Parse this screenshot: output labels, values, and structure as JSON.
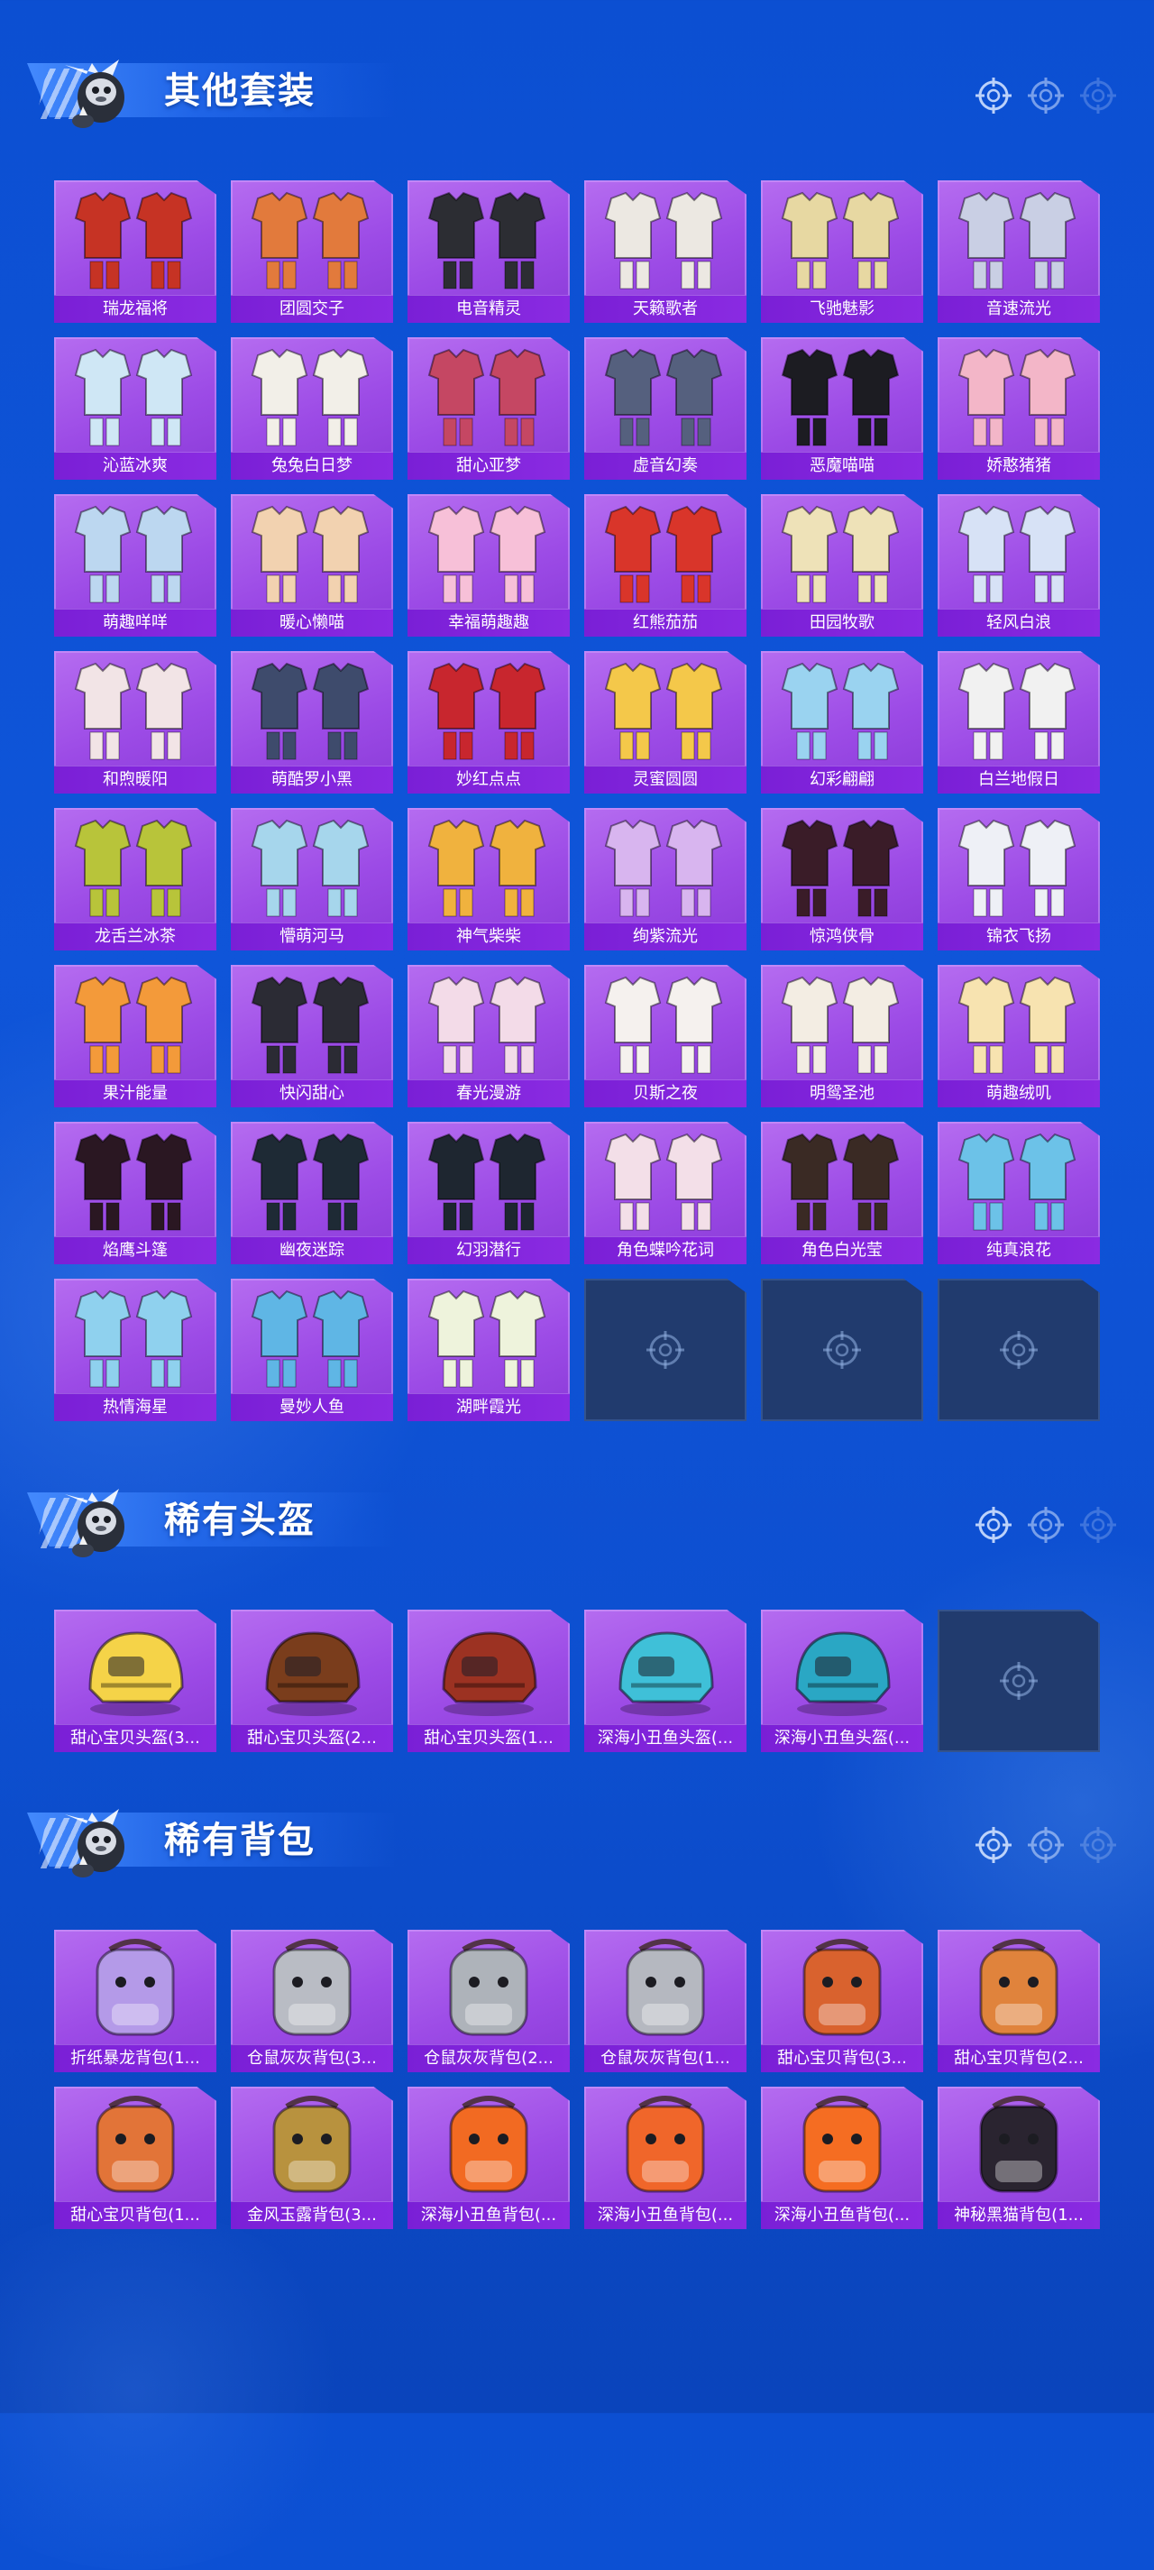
{
  "sections": [
    {
      "id": "suits",
      "title": "其他套装",
      "item_type": "suit",
      "items": [
        {
          "label": "瑞龙福将",
          "color": "#c63324"
        },
        {
          "label": "团圆交子",
          "color": "#e27a3c"
        },
        {
          "label": "电音精灵",
          "color": "#2c2d33"
        },
        {
          "label": "天籁歌者",
          "color": "#ece8e2"
        },
        {
          "label": "飞驰魅影",
          "color": "#e7d8a2"
        },
        {
          "label": "音速流光",
          "color": "#c9cfe4"
        },
        {
          "label": "沁蓝冰爽",
          "color": "#cfe7f5"
        },
        {
          "label": "兔兔白日梦",
          "color": "#f2efe8"
        },
        {
          "label": "甜心亚梦",
          "color": "#c54763"
        },
        {
          "label": "虚音幻奏",
          "color": "#55607e"
        },
        {
          "label": "恶魔喵喵",
          "color": "#1c1c22"
        },
        {
          "label": "娇憨猪猪",
          "color": "#f3b6c8"
        },
        {
          "label": "萌趣咩咩",
          "color": "#bcd7f0"
        },
        {
          "label": "暖心懒喵",
          "color": "#f2d2b0"
        },
        {
          "label": "幸福萌趣趣",
          "color": "#f7c0d8"
        },
        {
          "label": "红熊茄茄",
          "color": "#d9352a"
        },
        {
          "label": "田园牧歌",
          "color": "#eee2b8"
        },
        {
          "label": "轻风白浪",
          "color": "#d7e2f6"
        },
        {
          "label": "和煦暖阳",
          "color": "#f2e4e6"
        },
        {
          "label": "萌酷罗小黑",
          "color": "#3e4b6c"
        },
        {
          "label": "妙红点点",
          "color": "#c8262e"
        },
        {
          "label": "灵蜜圆圆",
          "color": "#f4c84a"
        },
        {
          "label": "幻彩翩翩",
          "color": "#9ad3f0"
        },
        {
          "label": "白兰地假日",
          "color": "#f1f1f1"
        },
        {
          "label": "龙舌兰冰茶",
          "color": "#b8c43a"
        },
        {
          "label": "懵萌河马",
          "color": "#a6d6ec"
        },
        {
          "label": "神气柴柴",
          "color": "#f0b23e"
        },
        {
          "label": "绚紫流光",
          "color": "#d8b5ef"
        },
        {
          "label": "惊鸿侠骨",
          "color": "#3a1c28"
        },
        {
          "label": "锦衣飞扬",
          "color": "#eef0f6"
        },
        {
          "label": "果汁能量",
          "color": "#f39a3a"
        },
        {
          "label": "快闪甜心",
          "color": "#2b2b34"
        },
        {
          "label": "春光漫游",
          "color": "#f3dbe8"
        },
        {
          "label": "贝斯之夜",
          "color": "#f5f1ee"
        },
        {
          "label": "明鸳圣池",
          "color": "#f3ede3"
        },
        {
          "label": "萌趣绒叽",
          "color": "#f7e3b0"
        },
        {
          "label": "焰鹰斗篷",
          "color": "#2a1722"
        },
        {
          "label": "幽夜迷踪",
          "color": "#1e2a35"
        },
        {
          "label": "幻羽潜行",
          "color": "#1e2630"
        },
        {
          "label": "角色蝶吟花词",
          "color": "#f3dfe8"
        },
        {
          "label": "角色白光莹",
          "color": "#3a2a24"
        },
        {
          "label": "纯真浪花",
          "color": "#6cc2e8"
        },
        {
          "label": "热情海星",
          "color": "#8fd1ee"
        },
        {
          "label": "曼妙人鱼",
          "color": "#5fb6e5"
        },
        {
          "label": "湖畔霞光",
          "color": "#eef3dc"
        }
      ],
      "empty_slots": 3
    },
    {
      "id": "helmets",
      "title": "稀有头盔",
      "item_type": "helmet",
      "items": [
        {
          "label": "甜心宝贝头盔(3...",
          "color": "#f5d348"
        },
        {
          "label": "甜心宝贝头盔(2...",
          "color": "#7a3d1c"
        },
        {
          "label": "甜心宝贝头盔(1...",
          "color": "#9c3222"
        },
        {
          "label": "深海小丑鱼头盔(...",
          "color": "#3fc0d8"
        },
        {
          "label": "深海小丑鱼头盔(...",
          "color": "#2aa7c4"
        }
      ],
      "empty_slots": 1
    },
    {
      "id": "backpacks",
      "title": "稀有背包",
      "item_type": "backpack",
      "items": [
        {
          "label": "折纸暴龙背包(1...",
          "color": "#b49ae8"
        },
        {
          "label": "仓鼠灰灰背包(3...",
          "color": "#b9bcc4"
        },
        {
          "label": "仓鼠灰灰背包(2...",
          "color": "#aeb3ba"
        },
        {
          "label": "仓鼠灰灰背包(1...",
          "color": "#b5b8c0"
        },
        {
          "label": "甜心宝贝背包(3...",
          "color": "#d9622e"
        },
        {
          "label": "甜心宝贝背包(2...",
          "color": "#e0833c"
        },
        {
          "label": "甜心宝贝背包(1...",
          "color": "#e27438"
        },
        {
          "label": "金风玉露背包(3...",
          "color": "#b8923e"
        },
        {
          "label": "深海小丑鱼背包(...",
          "color": "#f26a22"
        },
        {
          "label": "深海小丑鱼背包(...",
          "color": "#f0662a"
        },
        {
          "label": "深海小丑鱼背包(...",
          "color": "#f56d22"
        },
        {
          "label": "神秘黑猫背包(1...",
          "color": "#2a2430"
        }
      ],
      "empty_slots": 0
    }
  ]
}
